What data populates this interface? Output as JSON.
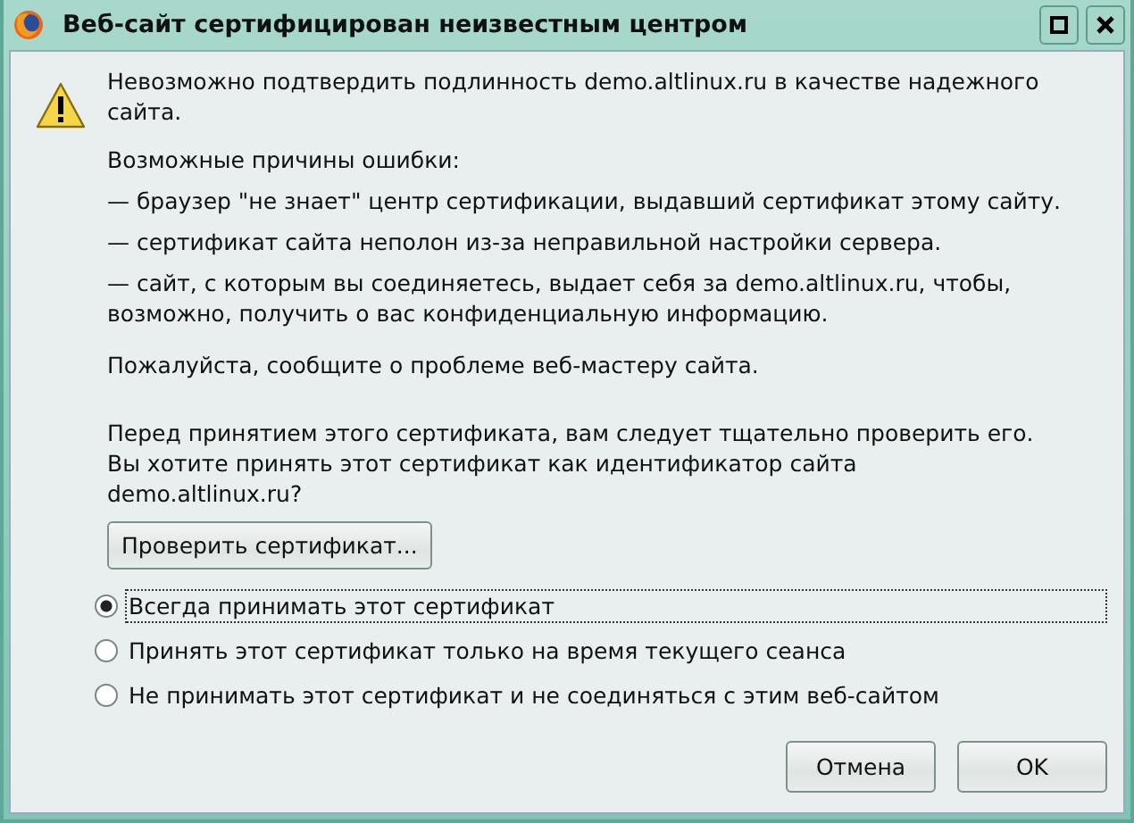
{
  "window": {
    "title": "Веб-сайт сертифицирован неизвестным центром"
  },
  "message": "Невозможно подтвердить подлинность demo.altlinux.ru в качестве надежного сайта.",
  "reasons_heading": "Возможные причины ошибки:",
  "reasons": [
    "— браузер \"не знает\" центр сертификации, выдавший сертификат этому сайту.",
    "— сертификат сайта неполон из-за неправильной настройки сервера.",
    "— сайт, с которым вы соединяетесь, выдает себя за demo.altlinux.ru, чтобы, возможно, получить о вас конфиденциальную информацию."
  ],
  "report": "Пожалуйста, сообщите о проблеме веб-мастеру сайта.",
  "question": "Перед принятием этого сертификата, вам следует тщательно проверить его. Вы хотите принять этот сертификат как идентификатор сайта demo.altlinux.ru?",
  "examine_button": "Проверить сертификат...",
  "options": [
    {
      "label": "Всегда принимать этот сертификат",
      "selected": true,
      "focused": true
    },
    {
      "label": "Принять этот сертификат только на время текущего сеанса",
      "selected": false,
      "focused": false
    },
    {
      "label": "Не принимать этот сертификат и не соединяться с этим веб-сайтом",
      "selected": false,
      "focused": false
    }
  ],
  "buttons": [
    "Отмена",
    "OK"
  ]
}
